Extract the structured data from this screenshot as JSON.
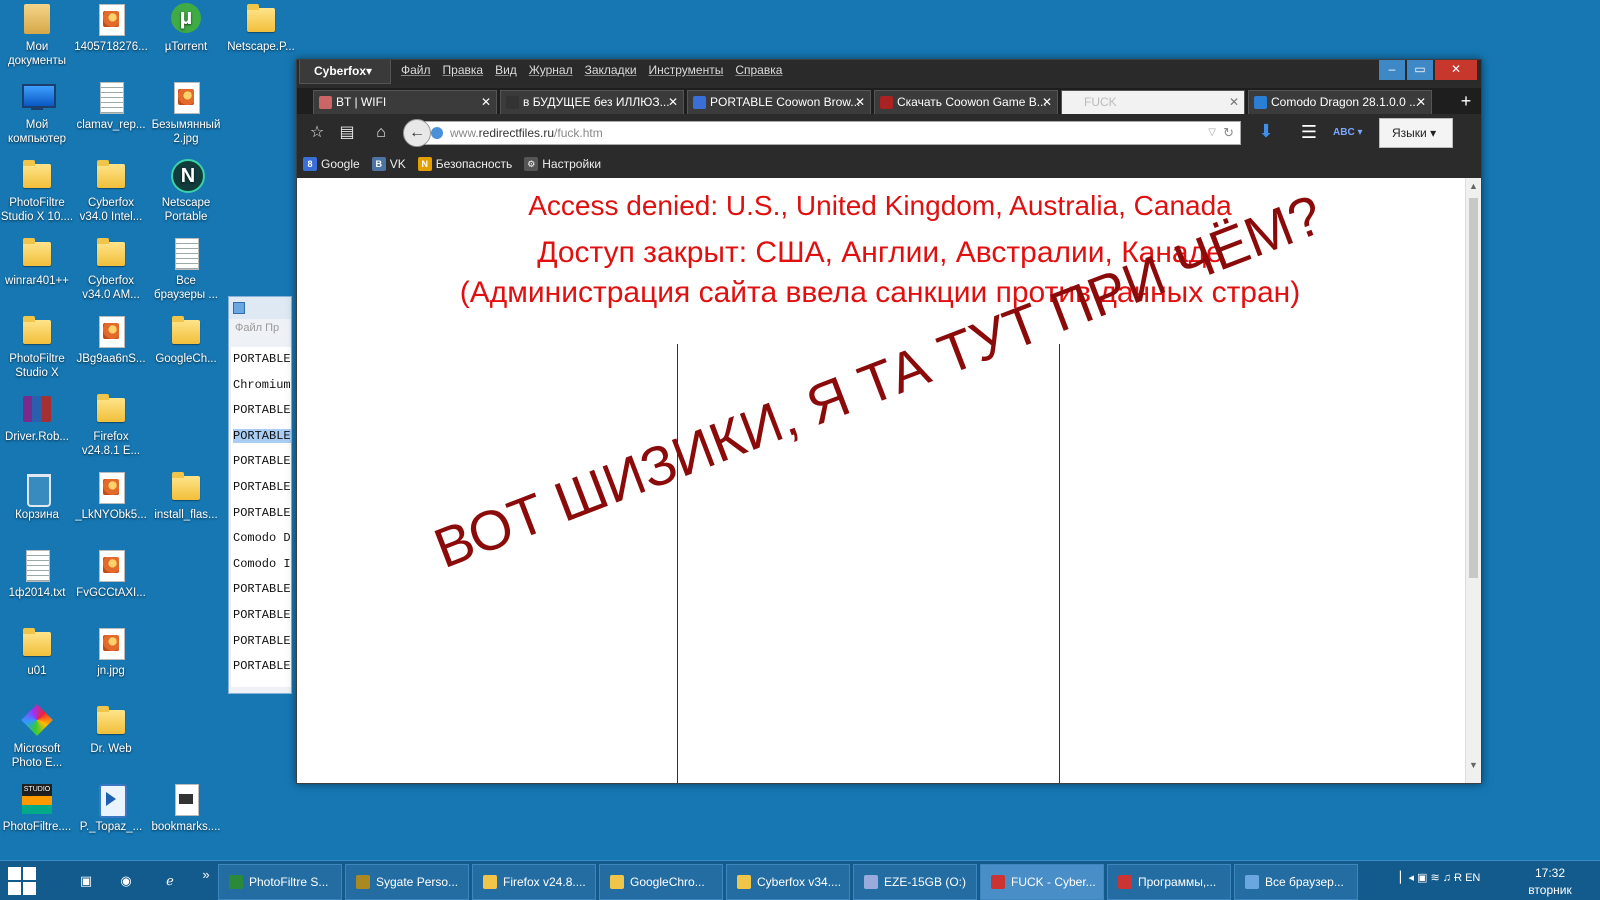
{
  "desktop": {
    "icons": [
      {
        "label": "Мои документы",
        "type": "docs"
      },
      {
        "label": "1405718276...",
        "type": "img"
      },
      {
        "label": "µTorrent",
        "type": "torrent"
      },
      {
        "label": "Netscape.P...",
        "type": "folder"
      },
      {
        "label": "Мой компьютер",
        "type": "pc"
      },
      {
        "label": "clamav_rep...",
        "type": "doc"
      },
      {
        "label": "Безымянный 2.jpg",
        "type": "img"
      },
      {
        "label": "PhotoFiltre Studio X 10....",
        "type": "folder"
      },
      {
        "label": "Cyberfox v34.0 Intel...",
        "type": "folder"
      },
      {
        "label": "Netscape Portable",
        "type": "netscape"
      },
      {
        "label": "winrar401++",
        "type": "folder"
      },
      {
        "label": "Cyberfox v34.0 AM...",
        "type": "folder"
      },
      {
        "label": "Все браузеры ...",
        "type": "doc"
      },
      {
        "label": "PhotoFiltre Studio X",
        "type": "folder"
      },
      {
        "label": "JBg9aa6nS...",
        "type": "img"
      },
      {
        "label": "GoogleCh...",
        "type": "folder"
      },
      {
        "label": "Driver.Rob...",
        "type": "rar"
      },
      {
        "label": "Firefox v24.8.1 E...",
        "type": "folder"
      },
      {
        "label": "Корзина",
        "type": "bin"
      },
      {
        "label": "_LkNYObk5...",
        "type": "img"
      },
      {
        "label": "install_flas...",
        "type": "folder"
      },
      {
        "label": "1ф2014.txt",
        "type": "doc"
      },
      {
        "label": "FvGCCtAXI...",
        "type": "img"
      },
      {
        "label": "u01",
        "type": "folder"
      },
      {
        "label": "jn.jpg",
        "type": "img"
      },
      {
        "label": "Microsoft Photo E...",
        "type": "photo"
      },
      {
        "label": "Dr. Web",
        "type": "folder"
      },
      {
        "label": "PhotoFiltre....",
        "type": "studio"
      },
      {
        "label": "P._Topaz_...",
        "type": "topaz"
      },
      {
        "label": "bookmarks....",
        "type": "html"
      }
    ]
  },
  "bg_window": {
    "menu": "Файл  Пр",
    "lines": [
      "PORTABLE",
      "Chromium",
      "PORTABLE",
      "PORTABLE",
      "PORTABLE",
      "PORTABLE",
      "PORTABLE",
      "Comodo D",
      "Comodo I",
      "PORTABLE",
      "PORTABLE",
      "PORTABLE",
      "PORTABLE"
    ]
  },
  "browser": {
    "app_button": "Cyberfox▾",
    "menu": [
      "Файл",
      "Правка",
      "Вид",
      "Журнал",
      "Закладки",
      "Инструменты",
      "Справка"
    ],
    "tabs": [
      {
        "title": "BT | WIFI",
        "icon_color": "#c66"
      },
      {
        "title": "в БУДУЩЕЕ без ИЛЛЮЗ...",
        "icon_color": "#333"
      },
      {
        "title": "PORTABLE Coowon Brow...",
        "icon_color": "#3b6fd8"
      },
      {
        "title": "Скачать Coowon Game B...",
        "icon_color": "#a22"
      },
      {
        "title": "FUCK",
        "icon_color": "#f2f2f2"
      },
      {
        "title": "Comodo Dragon 28.1.0.0 ...",
        "icon_color": "#2a7fd4"
      }
    ],
    "url_host": "www.",
    "url_main": "redirectfiles.ru",
    "url_path": "/fuck.htm",
    "lang_button": "Языки",
    "abc_label": "ABC",
    "bookmarks": [
      {
        "label": "Google",
        "badge": "8",
        "color": "#3b6fd8"
      },
      {
        "label": "VK",
        "badge": "B",
        "color": "#4c75a3"
      },
      {
        "label": "Безопасность",
        "badge": "N",
        "color": "#e5a000"
      },
      {
        "label": "Настройки",
        "badge": "⚙",
        "color": "#555"
      }
    ]
  },
  "page": {
    "line1": "Access denied: U.S., United Kingdom, Australia, Canada",
    "line2": "Доступ закрыт: США, Англии, Австралии, Канаде",
    "line3": "(Администрация сайта ввела санкции против данных стран)",
    "slanted": "ВОТ ШИЗИКИ, Я ТА ТУТ ПРИ ЧЁМ?"
  },
  "taskbar": {
    "buttons": [
      {
        "label": "PhotoFiltre S...",
        "color": "#2a8a3a"
      },
      {
        "label": "Sygate Perso...",
        "color": "#a82"
      },
      {
        "label": "Firefox v24.8....",
        "color": "#f1c44a"
      },
      {
        "label": "GoogleChro...",
        "color": "#f1c44a"
      },
      {
        "label": "Cyberfox v34....",
        "color": "#f1c44a"
      },
      {
        "label": "EZE-15GB (O:)",
        "color": "#9ad"
      },
      {
        "label": "FUCK - Cyber...",
        "color": "#c33"
      },
      {
        "label": "Программы,...",
        "color": "#c33"
      },
      {
        "label": "Все браузер...",
        "color": "#6aa6e0"
      }
    ],
    "tray_lang": "EN",
    "time": "17:32",
    "day": "вторник"
  }
}
